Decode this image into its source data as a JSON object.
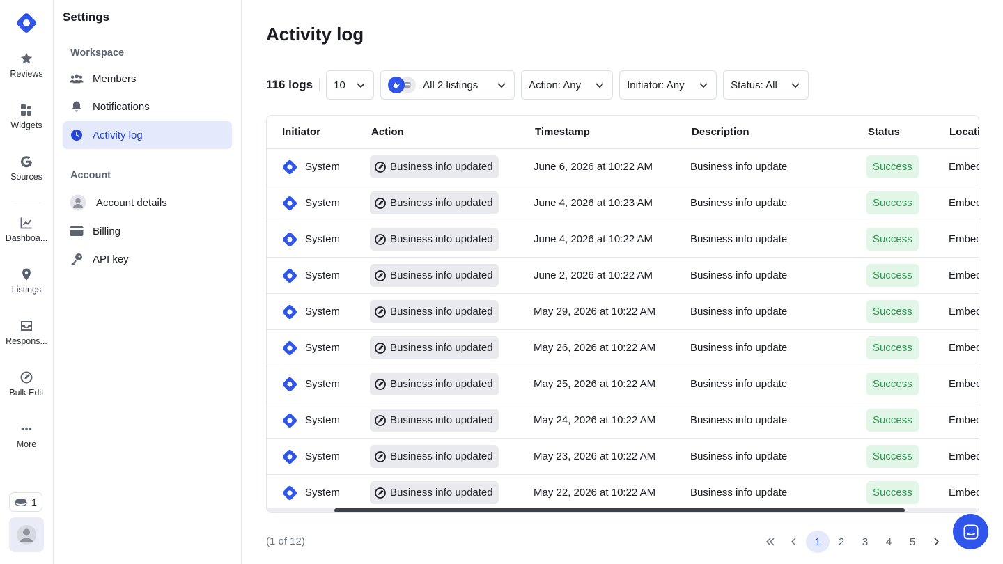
{
  "rail": {
    "items": [
      {
        "label": "Reviews",
        "icon": "star-icon"
      },
      {
        "label": "Widgets",
        "icon": "widgets-icon"
      },
      {
        "label": "Sources",
        "icon": "google-icon"
      },
      {
        "label": "Dashboa...",
        "icon": "chart-icon"
      },
      {
        "label": "Listings",
        "icon": "pin-icon"
      },
      {
        "label": "Respons...",
        "icon": "inbox-icon"
      },
      {
        "label": "Bulk Edit",
        "icon": "edit-icon"
      },
      {
        "label": "More",
        "icon": "more-icon"
      }
    ],
    "credits": "1"
  },
  "settings": {
    "title": "Settings",
    "workspace_label": "Workspace",
    "workspace_items": [
      "Members",
      "Notifications",
      "Activity log"
    ],
    "account_label": "Account",
    "account_items": [
      "Account details",
      "Billing",
      "API key"
    ]
  },
  "main": {
    "title": "Activity log",
    "log_count": "116 logs",
    "page_size": "10",
    "listings_filter": "All 2 listings",
    "action_filter": "Action: Any",
    "initiator_filter": "Initiator: Any",
    "status_filter": "Status: All"
  },
  "table": {
    "columns": [
      "Initiator",
      "Action",
      "Timestamp",
      "Description",
      "Status",
      "Locati"
    ],
    "rows": [
      {
        "initiator": "System",
        "action": "Business info updated",
        "timestamp": "June 6, 2026 at 10:22 AM",
        "description": "Business info update",
        "status": "Success",
        "location": "Embec"
      },
      {
        "initiator": "System",
        "action": "Business info updated",
        "timestamp": "June 4, 2026 at 10:23 AM",
        "description": "Business info update",
        "status": "Success",
        "location": "Embec"
      },
      {
        "initiator": "System",
        "action": "Business info updated",
        "timestamp": "June 4, 2026 at 10:22 AM",
        "description": "Business info update",
        "status": "Success",
        "location": "Embec"
      },
      {
        "initiator": "System",
        "action": "Business info updated",
        "timestamp": "June 2, 2026 at 10:22 AM",
        "description": "Business info update",
        "status": "Success",
        "location": "Embec"
      },
      {
        "initiator": "System",
        "action": "Business info updated",
        "timestamp": "May 29, 2026 at 10:22 AM",
        "description": "Business info update",
        "status": "Success",
        "location": "Embec"
      },
      {
        "initiator": "System",
        "action": "Business info updated",
        "timestamp": "May 26, 2026 at 10:22 AM",
        "description": "Business info update",
        "status": "Success",
        "location": "Embec"
      },
      {
        "initiator": "System",
        "action": "Business info updated",
        "timestamp": "May 25, 2026 at 10:22 AM",
        "description": "Business info update",
        "status": "Success",
        "location": "Embec"
      },
      {
        "initiator": "System",
        "action": "Business info updated",
        "timestamp": "May 24, 2026 at 10:22 AM",
        "description": "Business info update",
        "status": "Success",
        "location": "Embec"
      },
      {
        "initiator": "System",
        "action": "Business info updated",
        "timestamp": "May 23, 2026 at 10:22 AM",
        "description": "Business info update",
        "status": "Success",
        "location": "Embec"
      },
      {
        "initiator": "System",
        "action": "Business info updated",
        "timestamp": "May 22, 2026 at 10:22 AM",
        "description": "Business info update",
        "status": "Success",
        "location": "Embec"
      }
    ]
  },
  "pagination": {
    "info": "(1 of 12)",
    "pages": [
      "1",
      "2",
      "3",
      "4",
      "5"
    ],
    "current": "1"
  },
  "colors": {
    "accent": "#2f55ea",
    "success_bg": "#e2f6e7",
    "success_text": "#2e9a51"
  }
}
